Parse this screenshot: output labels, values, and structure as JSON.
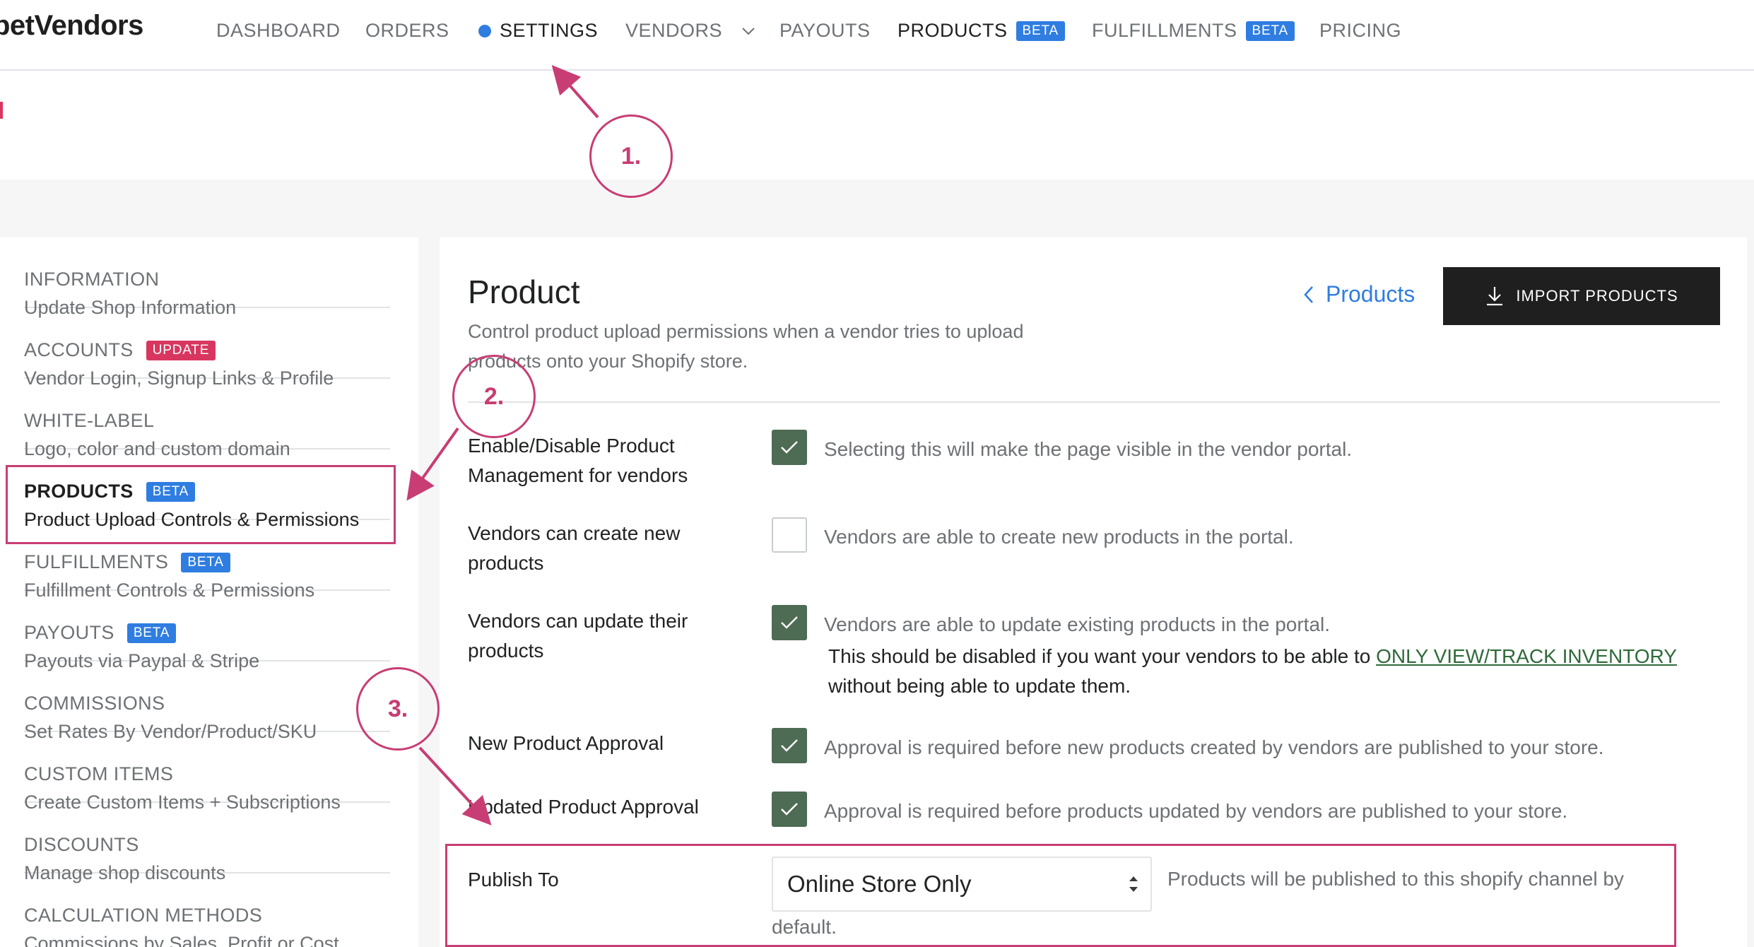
{
  "brand": "petVendors",
  "nav": {
    "dashboard": "DASHBOARD",
    "orders": "ORDERS",
    "settings": "SETTINGS",
    "vendors": "VENDORS",
    "payouts": "PAYOUTS",
    "products": "PRODUCTS",
    "products_badge": "BETA",
    "fulfillments": "FULFILLMENTS",
    "fulfillments_badge": "BETA",
    "pricing": "PRICING"
  },
  "sidebar": {
    "items": [
      {
        "title": "INFORMATION",
        "sub": "Update Shop Information"
      },
      {
        "title": "ACCOUNTS",
        "badge": "UPDATE",
        "sub": "Vendor Login, Signup Links & Profile"
      },
      {
        "title": "WHITE-LABEL",
        "sub": "Logo, color and custom domain"
      },
      {
        "title": "PRODUCTS",
        "badge": "BETA",
        "sub": "Product Upload Controls & Permissions"
      },
      {
        "title": "FULFILLMENTS",
        "badge": "BETA",
        "sub": "Fulfillment Controls & Permissions"
      },
      {
        "title": "PAYOUTS",
        "badge": "BETA",
        "sub": "Payouts via Paypal & Stripe"
      },
      {
        "title": "COMMISSIONS",
        "sub": "Set Rates By Vendor/Product/SKU"
      },
      {
        "title": "CUSTOM ITEMS",
        "sub": "Create Custom Items + Subscriptions"
      },
      {
        "title": "DISCOUNTS",
        "sub": "Manage shop discounts"
      },
      {
        "title": "CALCULATION METHODS",
        "sub": "Commissions by Sales, Profit or Cost"
      }
    ]
  },
  "main": {
    "title": "Product",
    "description": "Control product upload permissions when a vendor tries to upload products onto your Shopify store.",
    "back_link": "Products",
    "import_button": "IMPORT PRODUCTS",
    "settings": [
      {
        "label": "Enable/Disable Product Management for vendors",
        "checked": true,
        "help": "Selecting this will make the page visible in the vendor portal."
      },
      {
        "label": "Vendors can create new products",
        "checked": false,
        "help": "Vendors are able to create new products in the portal."
      },
      {
        "label": "Vendors can update their products",
        "checked": true,
        "help": "Vendors are able to update existing products in the portal.",
        "note_prefix": "This should be disabled if you want your vendors to be able to ",
        "note_link": "ONLY VIEW/TRACK INVENTORY",
        "note_suffix": "without being able to update them."
      },
      {
        "label": "New Product Approval",
        "checked": true,
        "help": "Approval is required before new products created by vendors are published to your store."
      },
      {
        "label": "Updated Product Approval",
        "checked": true,
        "help": "Approval is required before products updated by vendors are published to your store."
      }
    ],
    "publish": {
      "label": "Publish To",
      "selected": "Online Store Only",
      "help_line1": "Products will be published to this shopify channel by",
      "help_line2": "default."
    }
  },
  "annotations": {
    "step1": "1.",
    "step2": "2.",
    "step3": "3."
  },
  "colors": {
    "accent": "#2f7de1",
    "annotation": "#c83d74",
    "checkbox": "#4e6b54",
    "badge_red": "#d8365f"
  }
}
